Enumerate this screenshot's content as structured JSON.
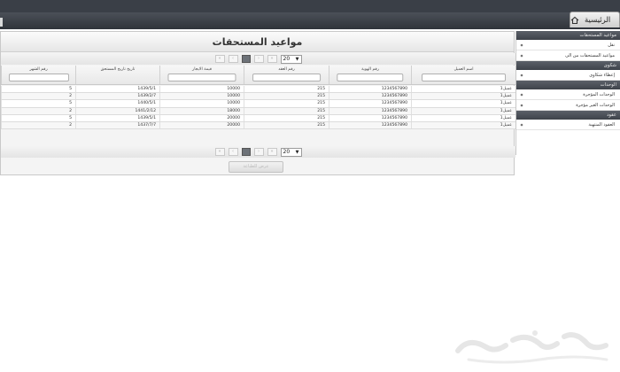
{
  "nav": {
    "home_label": "الرئيسية"
  },
  "sidebar": {
    "sections": [
      {
        "title": "مواعيد المستحقات",
        "items": [
          "نقل",
          "مواعيد المستحقات من الى"
        ]
      },
      {
        "title": "شكوى",
        "items": [
          "إعطاء شكاوى"
        ]
      },
      {
        "title": "الوحدات",
        "items": [
          "الوحدات المؤجرة",
          "الوحدات الغير مؤجرة"
        ]
      },
      {
        "title": "عقود",
        "items": [
          "العقود المنتهية"
        ]
      }
    ]
  },
  "panel": {
    "title": "مواعيد المستحقات"
  },
  "pager": {
    "page_size": "20"
  },
  "table": {
    "headers": [
      "اسم العميل",
      "رقم الهوية",
      "رقم العقد",
      "قيمة الايجار",
      "تاريخ تاريخ المستحق",
      "رقم الشهر"
    ],
    "rows": [
      [
        "عميل1",
        "1234567890",
        "215",
        "10000",
        "1439/5/1",
        "5"
      ],
      [
        "عميل1",
        "1234567890",
        "215",
        "10000",
        "1439/2/7",
        "2"
      ],
      [
        "عميل1",
        "1234567890",
        "215",
        "10000",
        "1440/5/1",
        "5"
      ],
      [
        "عميل1",
        "1234567890",
        "215",
        "18000",
        "1441/2/12",
        "2"
      ],
      [
        "عميل1",
        "1234567890",
        "215",
        "20000",
        "1439/5/1",
        "5"
      ],
      [
        "عميل1",
        "1234567890",
        "215",
        "20000",
        "1437/7/7",
        "2"
      ]
    ]
  },
  "print_button": {
    "label": "عرض للطباعة"
  },
  "watermark": {
    "text": "حراج"
  },
  "colors": {
    "nav_dark": "#3a3f47",
    "sidebar_head": "#4a4f57",
    "panel_bg": "#f4f4f4"
  }
}
